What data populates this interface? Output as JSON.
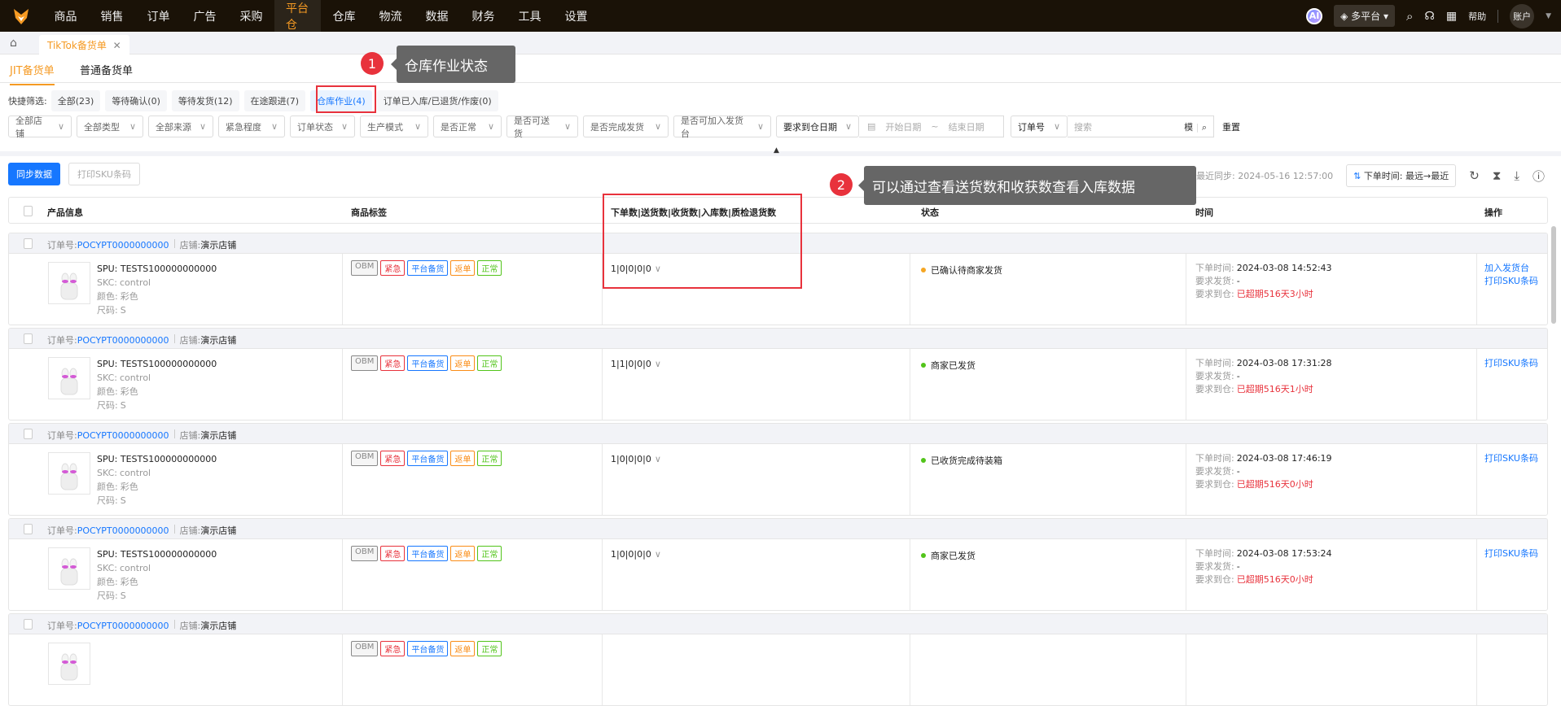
{
  "nav": {
    "items": [
      "商品",
      "销售",
      "订单",
      "广告",
      "采购",
      "平台仓",
      "仓库",
      "物流",
      "数据",
      "财务",
      "工具",
      "设置"
    ],
    "active_index": 5,
    "ai_label": "AI",
    "platform": "多平台",
    "help": "帮助",
    "account": "账户"
  },
  "tabs": {
    "active": "TikTok备货单",
    "close": "✕"
  },
  "subtabs": [
    "JIT备货单",
    "普通备货单"
  ],
  "quick_filter": {
    "label": "快捷筛选:",
    "chips": [
      "全部(23)",
      "等待确认(0)",
      "等待发货(12)",
      "在途跟进(7)",
      "仓库作业(4)",
      "订单已入库/已退货/作废(0)"
    ],
    "active_index": 4
  },
  "filters": {
    "selects": [
      "全部店铺",
      "全部类型",
      "全部来源",
      "紧急程度",
      "订单状态",
      "生产模式",
      "是否正常",
      "是否可送货",
      "是否完成发货",
      "是否可加入发货台"
    ],
    "date_type": "要求到仓日期",
    "date_start": "开始日期",
    "date_sep": "~",
    "date_end": "结束日期",
    "search_type": "订单号",
    "search_placeholder": "搜索",
    "fuzzy": "模",
    "reset": "重置"
  },
  "toolbar": {
    "sync": "同步数据",
    "print": "打印SKU条码",
    "last_sync": "最近同步: 2024-05-16 12:57:00",
    "sort": "下单时间: 最远→最近"
  },
  "table": {
    "headers": [
      "产品信息",
      "商品标签",
      "下单数|送货数|收货数|入库数|质检退货数",
      "状态",
      "时间",
      "操作"
    ]
  },
  "labels": {
    "order_no": "订单号:",
    "shop": "店铺:",
    "skc": "SKC:",
    "color": "颜色:",
    "size": "尺码:",
    "order_time": "下单时间:",
    "ship_req": "要求发货:",
    "arrive_req": "要求到仓:"
  },
  "tag_colors": {
    "OBM": "#888888",
    "紧急": "#e8323c",
    "平台备货": "#1677ff",
    "返单": "#fa8c16",
    "正常": "#52c41a"
  },
  "main": {
    "rows": [
      {
        "order_no": "POCYPT0000000000",
        "shop": "演示店铺",
        "spu": "SPU: TESTS100000000000",
        "skc": "control",
        "color": "彩色",
        "size": "S",
        "tags": [
          "OBM",
          "紧急",
          "平台备货",
          "返单",
          "正常"
        ],
        "qty": "1|0|0|0|0",
        "status": "已确认待商家发货",
        "status_color": "#f5a623",
        "order_time": "2024-03-08 14:52:43",
        "ship_req": "-",
        "arrive_req": "已超期516天3小时",
        "ops": [
          "加入发货台",
          "打印SKU条码"
        ]
      },
      {
        "order_no": "POCYPT0000000000",
        "shop": "演示店铺",
        "spu": "SPU: TESTS100000000000",
        "skc": "control",
        "color": "彩色",
        "size": "S",
        "tags": [
          "OBM",
          "紧急",
          "平台备货",
          "返单",
          "正常"
        ],
        "qty": "1|1|0|0|0",
        "status": "商家已发货",
        "status_color": "#52c41a",
        "order_time": "2024-03-08 17:31:28",
        "ship_req": "-",
        "arrive_req": "已超期516天1小时",
        "ops": [
          "打印SKU条码"
        ]
      },
      {
        "order_no": "POCYPT0000000000",
        "shop": "演示店铺",
        "spu": "SPU: TESTS100000000000",
        "skc": "control",
        "color": "彩色",
        "size": "S",
        "tags": [
          "OBM",
          "紧急",
          "平台备货",
          "返单",
          "正常"
        ],
        "qty": "1|0|0|0|0",
        "status": "已收货完成待装箱",
        "status_color": "#52c41a",
        "order_time": "2024-03-08 17:46:19",
        "ship_req": "-",
        "arrive_req": "已超期516天0小时",
        "ops": [
          "打印SKU条码"
        ]
      },
      {
        "order_no": "POCYPT0000000000",
        "shop": "演示店铺",
        "spu": "SPU: TESTS100000000000",
        "skc": "control",
        "color": "彩色",
        "size": "S",
        "tags": [
          "OBM",
          "紧急",
          "平台备货",
          "返单",
          "正常"
        ],
        "qty": "1|0|0|0|0",
        "status": "商家已发货",
        "status_color": "#52c41a",
        "order_time": "2024-03-08 17:53:24",
        "ship_req": "-",
        "arrive_req": "已超期516天0小时",
        "ops": [
          "打印SKU条码"
        ]
      },
      {
        "order_no": "POCYPT0000000000",
        "shop": "演示店铺",
        "spu": "",
        "skc": "",
        "color": "",
        "size": "",
        "tags": [
          "OBM",
          "紧急",
          "平台备货",
          "返单",
          "正常"
        ],
        "qty": "",
        "status": "",
        "status_color": "#52c41a",
        "order_time": "",
        "ship_req": "",
        "arrive_req": "",
        "ops": []
      }
    ]
  },
  "annotations": {
    "one_num": "1",
    "one_text": "仓库作业状态",
    "two_num": "2",
    "two_text": "可以通过查看送货数和收获数查看入库数据"
  }
}
